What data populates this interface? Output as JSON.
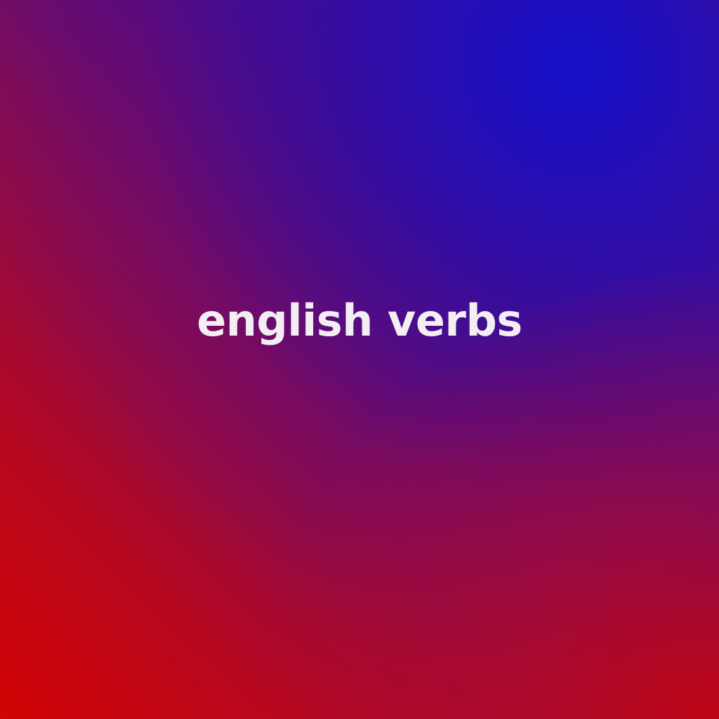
{
  "title": "english verbs",
  "colors": {
    "top_right": "#1410c8",
    "bottom_left": "#d20404",
    "bottom_right": "#cd0505",
    "text": "#f3eef3"
  }
}
